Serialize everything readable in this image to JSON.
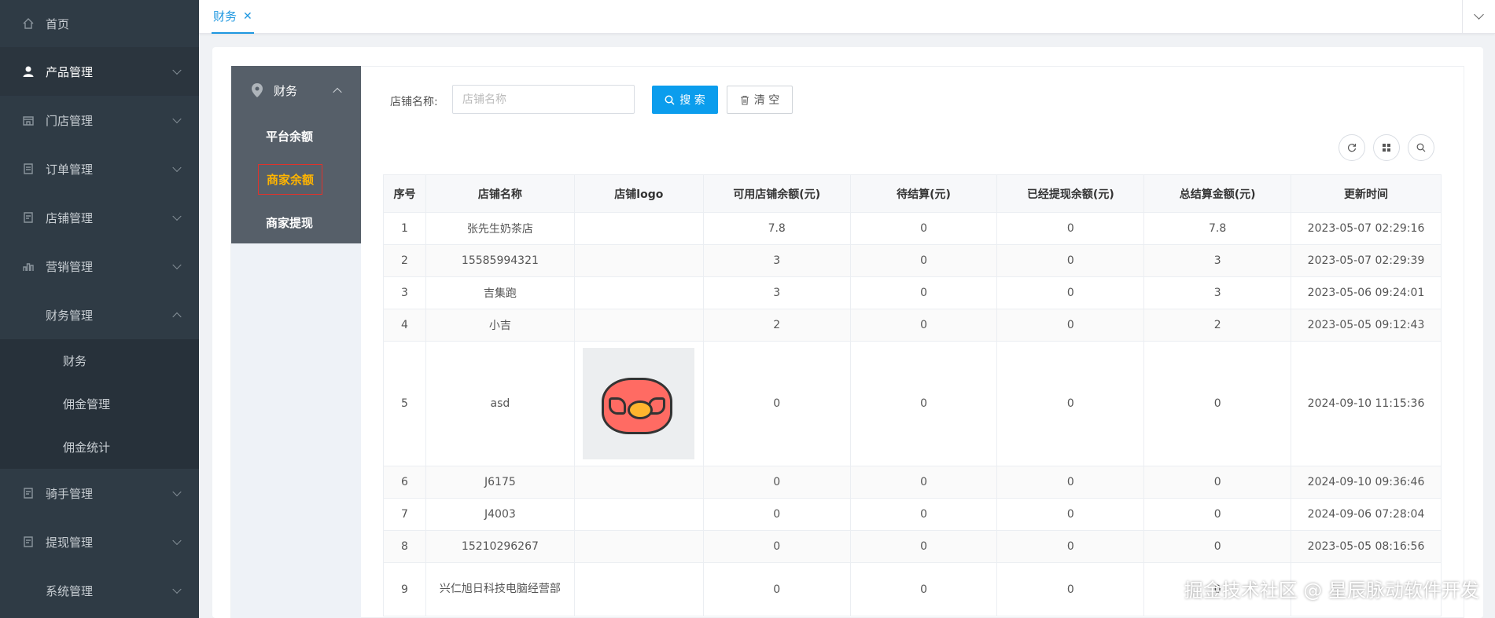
{
  "sidebar": {
    "items": [
      {
        "label": "首页",
        "icon": "home-icon"
      },
      {
        "label": "产品管理",
        "icon": "user-icon"
      },
      {
        "label": "门店管理",
        "icon": "store-icon"
      },
      {
        "label": "订单管理",
        "icon": "order-icon"
      },
      {
        "label": "店铺管理",
        "icon": "shop-icon"
      },
      {
        "label": "营销管理",
        "icon": "bar-chart-icon"
      },
      {
        "label": "财务管理",
        "icon": "finance-icon"
      },
      {
        "label": "骑手管理",
        "icon": "rider-icon"
      },
      {
        "label": "提现管理",
        "icon": "withdraw-icon"
      },
      {
        "label": "系统管理",
        "icon": "system-icon"
      }
    ],
    "finance_submenu": [
      "财务",
      "佣金管理",
      "佣金统计"
    ]
  },
  "topbar": {
    "tab_label": "财务",
    "tab_close": "✕"
  },
  "subnav": {
    "title": "财务",
    "items": [
      "平台余额",
      "商家余额",
      "商家提现"
    ],
    "active": "商家余额"
  },
  "search": {
    "label": "店铺名称:",
    "placeholder": "店铺名称",
    "value": "",
    "search_button": "搜 索",
    "clear_button": "清 空"
  },
  "toolbar": {
    "icons": [
      "refresh-icon",
      "grid-icon",
      "search-icon"
    ]
  },
  "table": {
    "headers": [
      "序号",
      "店铺名称",
      "店铺logo",
      "可用店铺余额(元)",
      "待结算(元)",
      "已经提现余额(元)",
      "总结算金额(元)",
      "更新时间"
    ],
    "rows": [
      {
        "idx": "1",
        "name": "张先生奶茶店",
        "logo": "",
        "available": "7.8",
        "pending": "0",
        "withdrawn": "0",
        "total": "7.8",
        "updated": "2023-05-07 02:29:16"
      },
      {
        "idx": "2",
        "name": "15585994321",
        "logo": "",
        "available": "3",
        "pending": "0",
        "withdrawn": "0",
        "total": "3",
        "updated": "2023-05-07 02:29:39"
      },
      {
        "idx": "3",
        "name": "吉集跑",
        "logo": "",
        "available": "3",
        "pending": "0",
        "withdrawn": "0",
        "total": "3",
        "updated": "2023-05-06 09:24:01"
      },
      {
        "idx": "4",
        "name": "小吉",
        "logo": "",
        "available": "2",
        "pending": "0",
        "withdrawn": "0",
        "total": "2",
        "updated": "2023-05-05 09:12:43"
      },
      {
        "idx": "5",
        "name": "asd",
        "logo": "pig-logo",
        "available": "0",
        "pending": "0",
        "withdrawn": "0",
        "total": "0",
        "updated": "2024-09-10 11:15:36"
      },
      {
        "idx": "6",
        "name": "J6175",
        "logo": "",
        "available": "0",
        "pending": "0",
        "withdrawn": "0",
        "total": "0",
        "updated": "2024-09-10 09:36:46"
      },
      {
        "idx": "7",
        "name": "J4003",
        "logo": "",
        "available": "0",
        "pending": "0",
        "withdrawn": "0",
        "total": "0",
        "updated": "2024-09-06 07:28:04"
      },
      {
        "idx": "8",
        "name": "15210296267",
        "logo": "",
        "available": "0",
        "pending": "0",
        "withdrawn": "0",
        "total": "0",
        "updated": "2023-05-05 08:16:56"
      },
      {
        "idx": "9",
        "name": "兴仁旭日科技电脑经营部",
        "logo": "",
        "available": "0",
        "pending": "0",
        "withdrawn": "0",
        "total": "0",
        "updated": ""
      }
    ]
  },
  "watermark": "掘金技术社区 @ 星辰脉动软件开发",
  "colors": {
    "sidebar_bg": "#2f3b45",
    "accent": "#0b9ded",
    "active_sub": "#ffb400",
    "active_border": "#e0322b"
  }
}
